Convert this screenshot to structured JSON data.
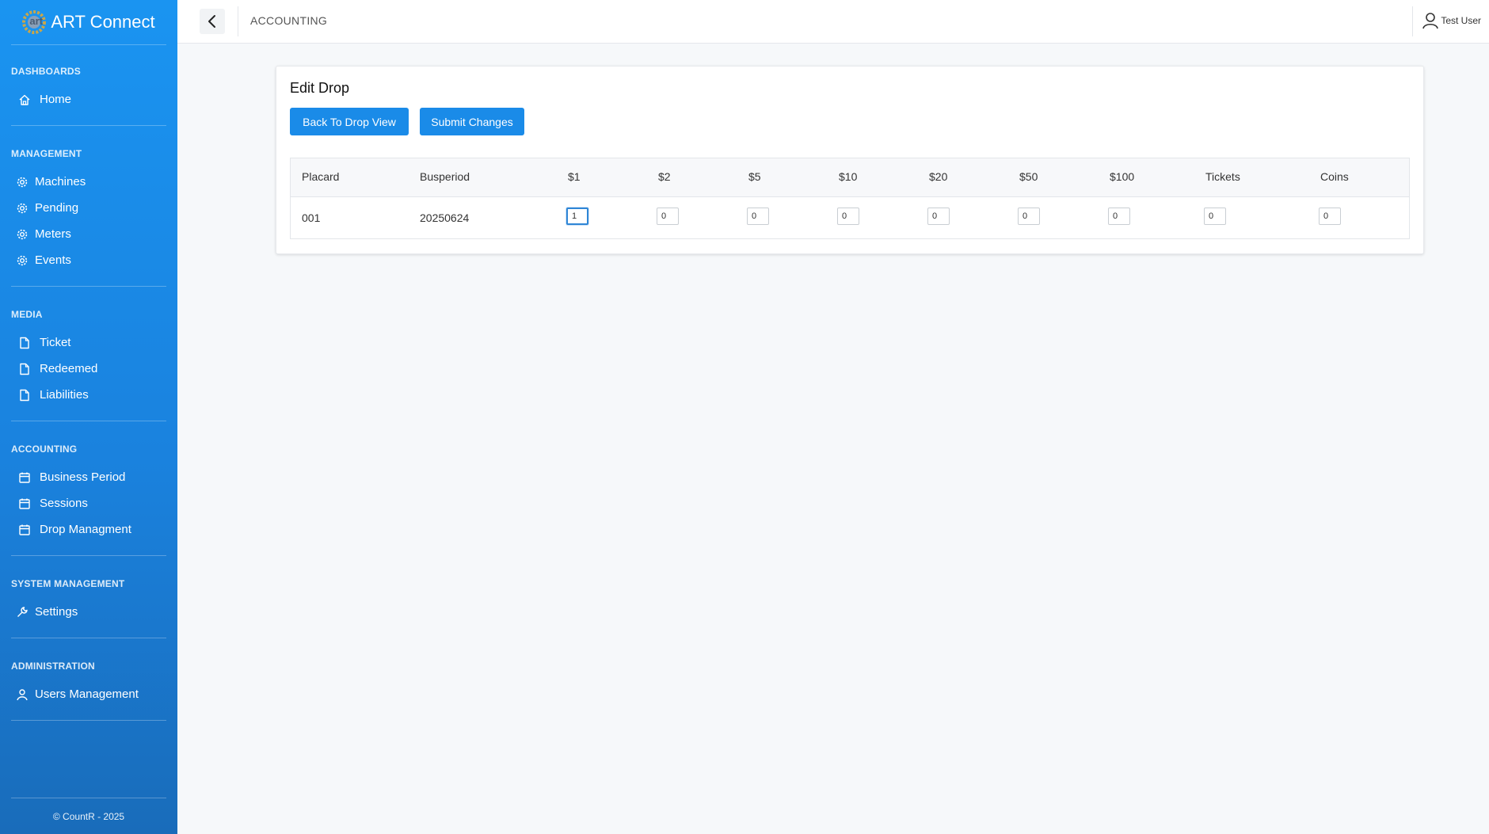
{
  "brand": {
    "name": "ART Connect",
    "logo_text": "art"
  },
  "topbar": {
    "breadcrumb": "ACCOUNTING",
    "user_name": "Test User"
  },
  "sidebar": {
    "sections": [
      {
        "title": "DASHBOARDS",
        "items": [
          {
            "label": "Home",
            "icon": "home-icon"
          }
        ]
      },
      {
        "title": "MANAGEMENT",
        "items": [
          {
            "label": "Machines",
            "icon": "gear-icon"
          },
          {
            "label": "Pending",
            "icon": "gear-icon"
          },
          {
            "label": "Meters",
            "icon": "gear-icon"
          },
          {
            "label": "Events",
            "icon": "gear-icon"
          }
        ]
      },
      {
        "title": "MEDIA",
        "items": [
          {
            "label": "Ticket",
            "icon": "file-icon"
          },
          {
            "label": "Redeemed",
            "icon": "file-icon"
          },
          {
            "label": "Liabilities",
            "icon": "file-icon"
          }
        ]
      },
      {
        "title": "ACCOUNTING",
        "items": [
          {
            "label": "Business Period",
            "icon": "calendar-icon"
          },
          {
            "label": "Sessions",
            "icon": "calendar-icon"
          },
          {
            "label": "Drop Managment",
            "icon": "calendar-icon"
          }
        ]
      },
      {
        "title": "SYSTEM MANAGEMENT",
        "items": [
          {
            "label": "Settings",
            "icon": "wrench-icon"
          }
        ]
      },
      {
        "title": "ADMINISTRATION",
        "items": [
          {
            "label": "Users Management",
            "icon": "user-icon"
          }
        ]
      }
    ],
    "footer": "© CountR - 2025"
  },
  "card": {
    "title": "Edit Drop",
    "back_button": "Back To Drop View",
    "submit_button": "Submit Changes"
  },
  "table": {
    "columns": [
      "Placard",
      "Busperiod",
      "$1",
      "$2",
      "$5",
      "$10",
      "$20",
      "$50",
      "$100",
      "Tickets",
      "Coins"
    ],
    "row": {
      "placard": "001",
      "busperiod": "20250624",
      "inputs": [
        "1",
        "0",
        "0",
        "0",
        "0",
        "0",
        "0",
        "0",
        "0"
      ]
    }
  }
}
